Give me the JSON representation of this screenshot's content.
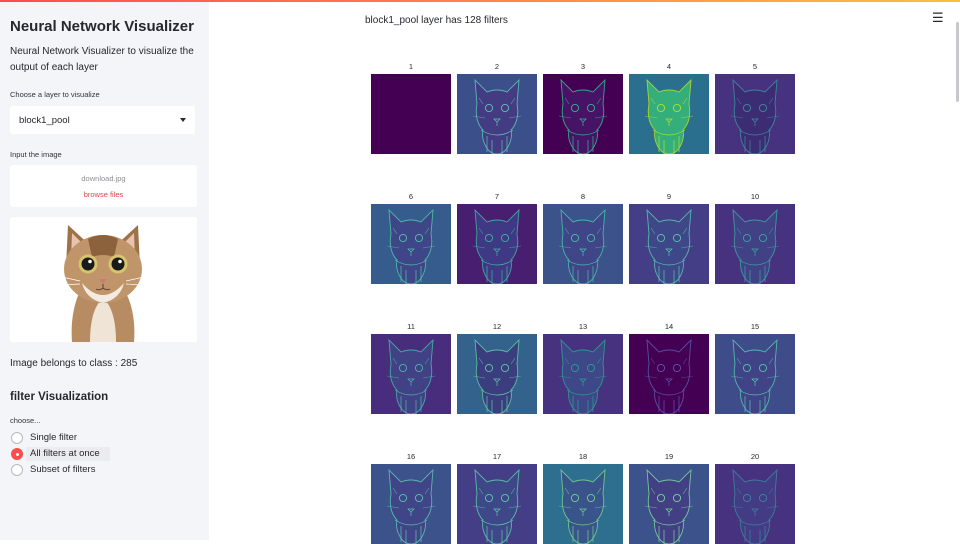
{
  "sidebar": {
    "title": "Neural Network Visualizer",
    "description": "Neural Network Visualizer to visualize the output of each layer",
    "layer_label": "Choose a layer to visualize",
    "layer_value": "block1_pool",
    "input_label": "Input the image",
    "file_name": "download.jpg",
    "browse_label": "browse files",
    "class_text": "Image belongs to class : 285",
    "section_title": "filter Visualization",
    "choose_label": "choose...",
    "radio_options": [
      "Single filter",
      "All filters at once",
      "Subset of filters"
    ],
    "radio_selected": "All filters at once"
  },
  "main": {
    "layer_info": "block1_pool layer has 128 filters",
    "menu_icon": "hamburger-menu-icon",
    "filters": [
      {
        "label": "1",
        "bg": "#440154",
        "face": "#440154",
        "edge": "#440154"
      },
      {
        "label": "2",
        "bg": "#3b4f8b",
        "face": "#443a83",
        "edge": "#5fc2b4"
      },
      {
        "label": "3",
        "bg": "#440154",
        "face": "#471669",
        "edge": "#36b88e"
      },
      {
        "label": "4",
        "bg": "#2b6f8e",
        "face": "#35b779",
        "edge": "#b5de2b"
      },
      {
        "label": "5",
        "bg": "#46327e",
        "face": "#3b2c73",
        "edge": "#3c8e9e"
      },
      {
        "label": "6",
        "bg": "#365c8d",
        "face": "#414487",
        "edge": "#4ec3a9"
      },
      {
        "label": "7",
        "bg": "#481f70",
        "face": "#3f3c88",
        "edge": "#3eb4a1"
      },
      {
        "label": "8",
        "bg": "#3b528b",
        "face": "#414487",
        "edge": "#48c0a9"
      },
      {
        "label": "9",
        "bg": "#433e85",
        "face": "#3e4a89",
        "edge": "#5bc2b0"
      },
      {
        "label": "10",
        "bg": "#46327e",
        "face": "#414487",
        "edge": "#3ea2a5"
      },
      {
        "label": "11",
        "bg": "#472d7b",
        "face": "#414487",
        "edge": "#4ab5aa"
      },
      {
        "label": "12",
        "bg": "#33638d",
        "face": "#3b3a7e",
        "edge": "#62c6a2"
      },
      {
        "label": "13",
        "bg": "#46327e",
        "face": "#3e4a89",
        "edge": "#2da191"
      },
      {
        "label": "14",
        "bg": "#440154",
        "face": "#440154",
        "edge": "#5b58a8"
      },
      {
        "label": "15",
        "bg": "#3e4c8a",
        "face": "#414487",
        "edge": "#55c3ae"
      },
      {
        "label": "16",
        "bg": "#3b528b",
        "face": "#414487",
        "edge": "#5cc3b0"
      },
      {
        "label": "17",
        "bg": "#433e85",
        "face": "#3e4a89",
        "edge": "#5fc8aa"
      },
      {
        "label": "18",
        "bg": "#2e6e8e",
        "face": "#3b528b",
        "edge": "#74d08e"
      },
      {
        "label": "19",
        "bg": "#3b528b",
        "face": "#433e85",
        "edge": "#7ad49a"
      },
      {
        "label": "20",
        "bg": "#46327e",
        "face": "#433e85",
        "edge": "#3e84a0"
      }
    ]
  }
}
